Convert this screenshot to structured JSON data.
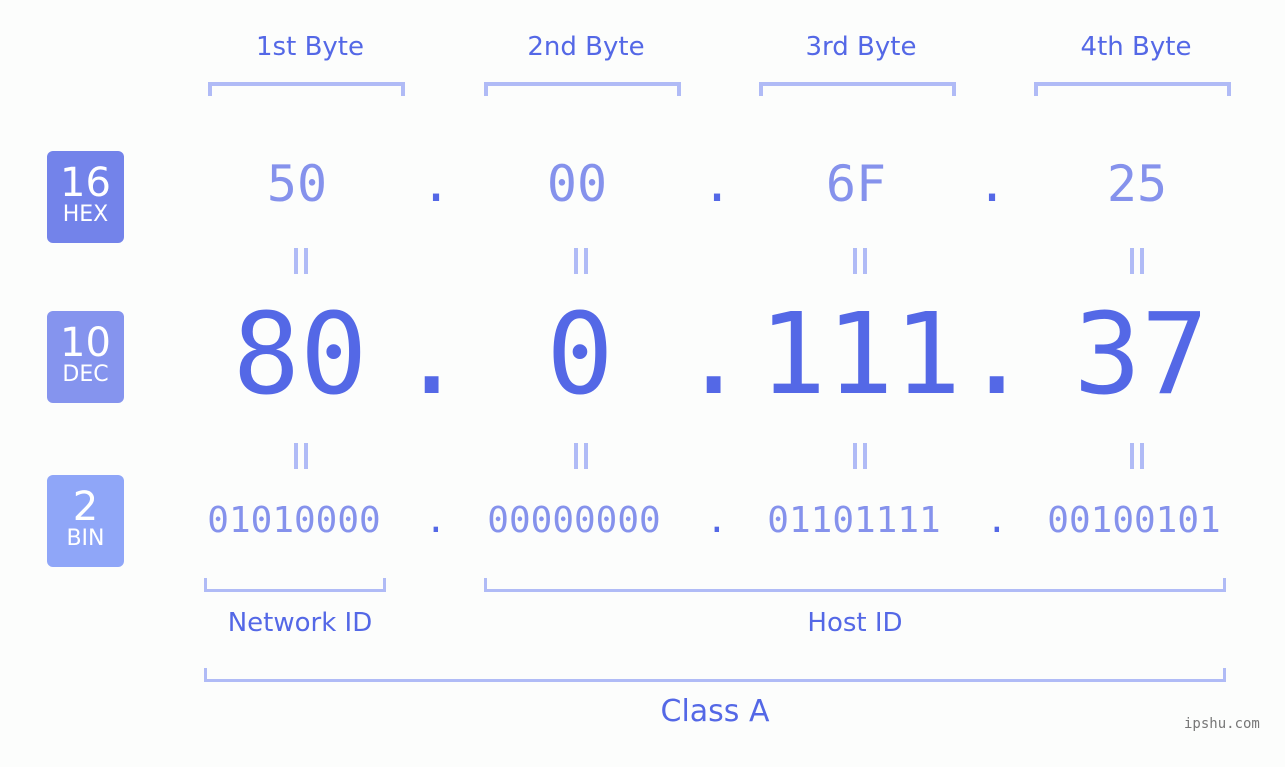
{
  "bytes": [
    {
      "label": "1st Byte",
      "hex": "50",
      "dec": "80",
      "bin": "01010000"
    },
    {
      "label": "2nd Byte",
      "hex": "00",
      "dec": "0",
      "bin": "00000000"
    },
    {
      "label": "3rd Byte",
      "hex": "6F",
      "dec": "111",
      "bin": "01101111"
    },
    {
      "label": "4th Byte",
      "hex": "25",
      "dec": "37",
      "bin": "00100101"
    }
  ],
  "separator": ".",
  "badges": {
    "hex": {
      "base": "16",
      "name": "HEX",
      "color": "#7383ea"
    },
    "dec": {
      "base": "10",
      "name": "DEC",
      "color": "#8594ee"
    },
    "bin": {
      "base": "2",
      "name": "BIN",
      "color": "#8fa6f8"
    }
  },
  "segments": {
    "network": "Network ID",
    "host": "Host ID",
    "class": "Class A"
  },
  "watermark": "ipshu.com",
  "colors": {
    "accent": "#5468e6",
    "light": "#8592ec",
    "bracket": "#b0bbf6"
  }
}
